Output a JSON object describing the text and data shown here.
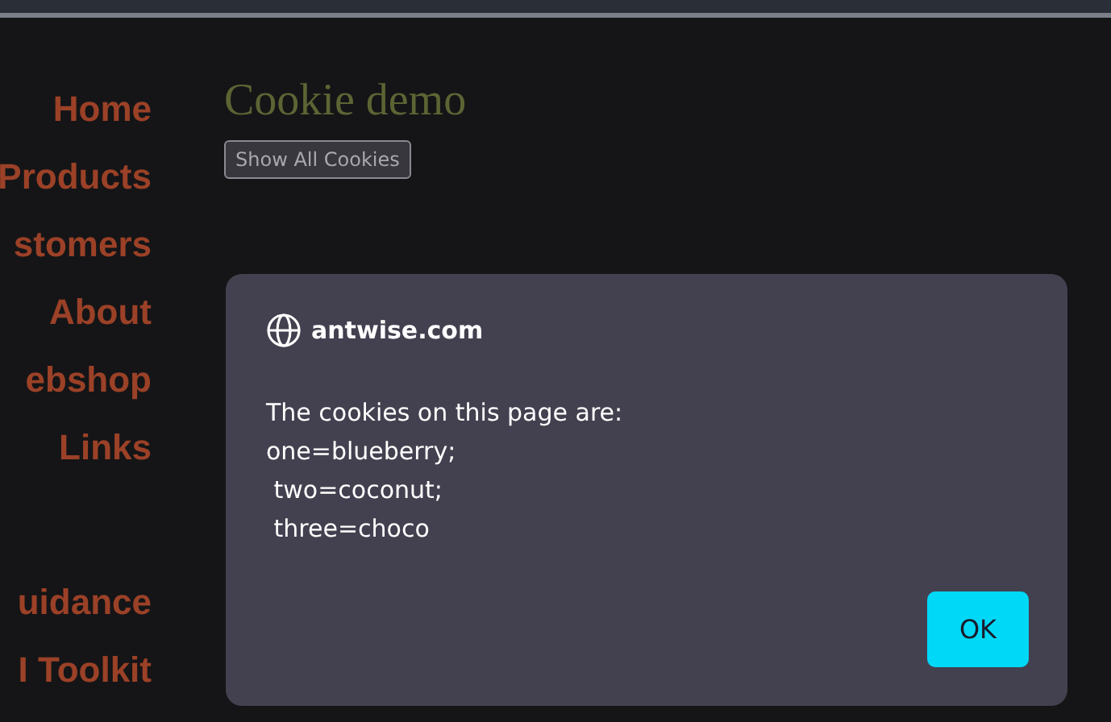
{
  "nav": {
    "items": [
      {
        "label": "Home"
      },
      {
        "label": "Products"
      },
      {
        "label": "stomers"
      },
      {
        "label": "About"
      },
      {
        "label": "ebshop"
      },
      {
        "label": "Links"
      },
      {
        "kind": "spacer"
      },
      {
        "label": "uidance"
      },
      {
        "label": "I Toolkit"
      }
    ]
  },
  "page": {
    "title": "Cookie demo",
    "button": "Show All Cookies"
  },
  "dialog": {
    "site": "antwise.com",
    "lines": [
      "The cookies on this page are:",
      "one=blueberry;",
      " two=coconut;",
      " three=choco"
    ],
    "ok": "OK"
  }
}
